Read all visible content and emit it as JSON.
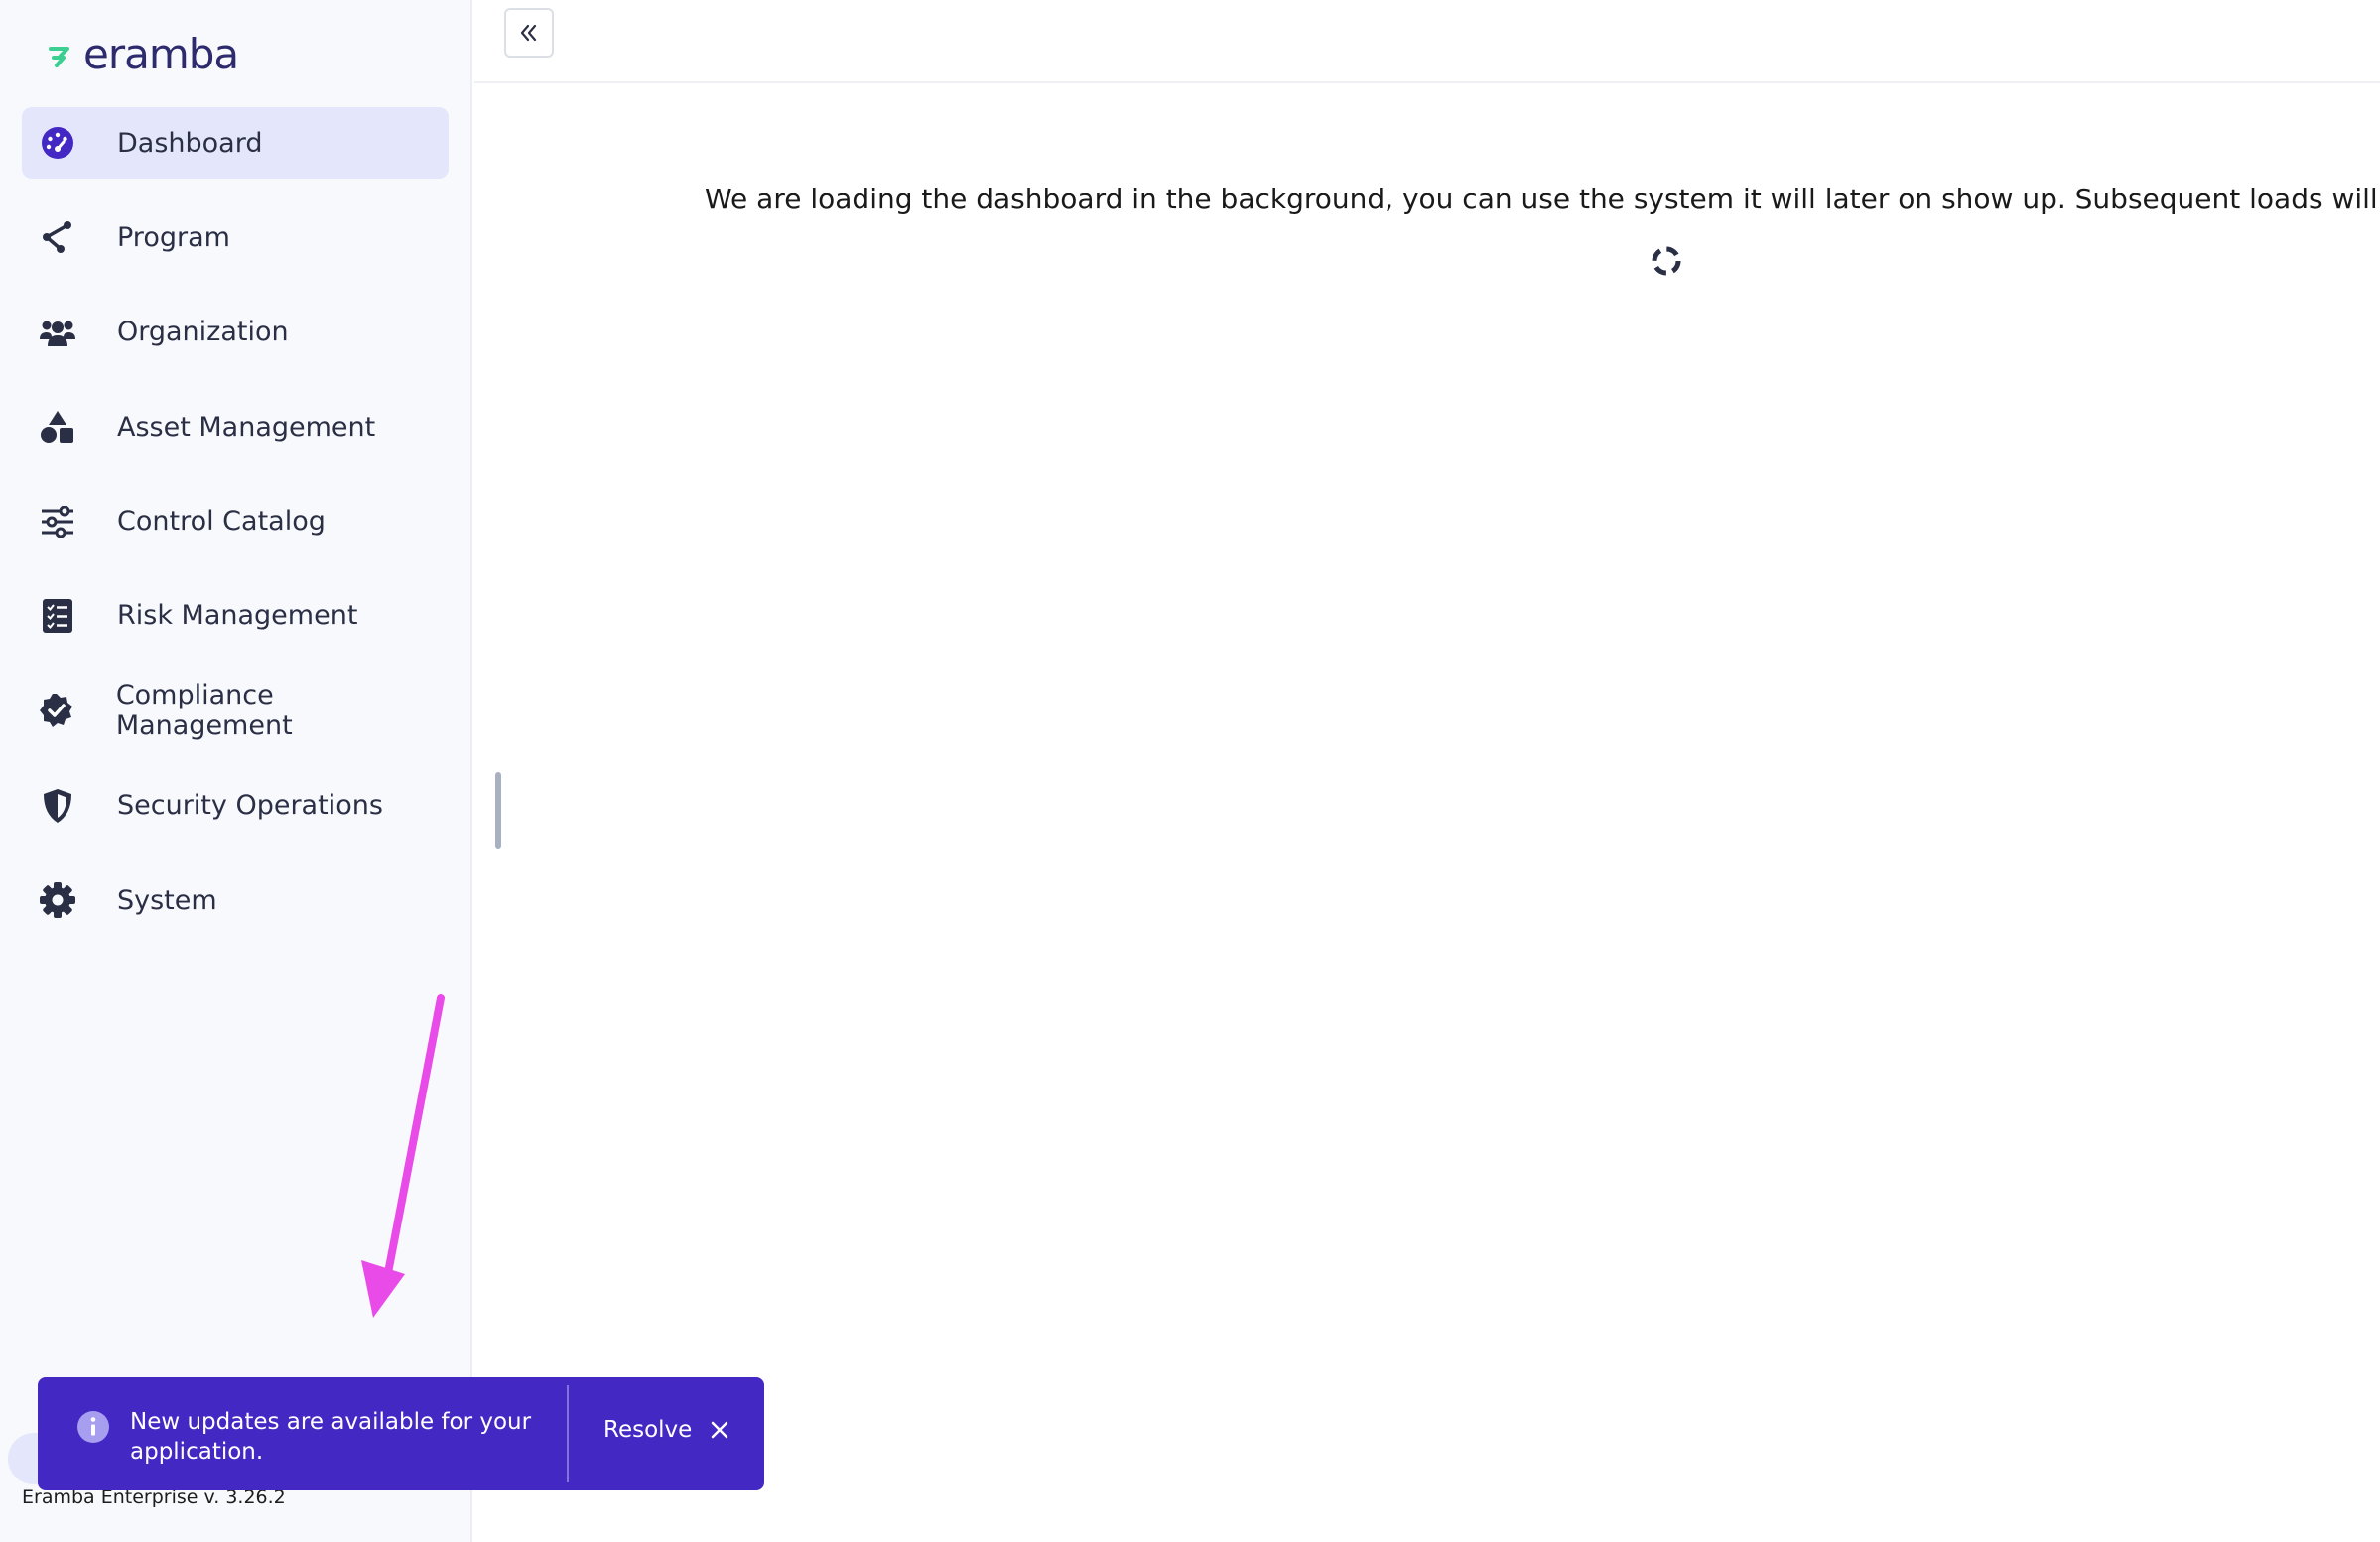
{
  "app": {
    "logo_text": "eramba",
    "version": "Eramba Enterprise v. 3.26.2"
  },
  "sidebar": {
    "items": [
      {
        "label": "Dashboard",
        "icon": "dashboard-icon",
        "active": true
      },
      {
        "label": "Program",
        "icon": "program-icon",
        "active": false
      },
      {
        "label": "Organization",
        "icon": "users-icon",
        "active": false
      },
      {
        "label": "Asset Management",
        "icon": "shapes-icon",
        "active": false
      },
      {
        "label": "Control Catalog",
        "icon": "sliders-icon",
        "active": false
      },
      {
        "label": "Risk Management",
        "icon": "checklist-icon",
        "active": false
      },
      {
        "label": "Compliance Management",
        "icon": "badge-check-icon",
        "active": false
      },
      {
        "label": "Security Operations",
        "icon": "shield-icon",
        "active": false
      },
      {
        "label": "System",
        "icon": "gear-icon",
        "active": false
      }
    ]
  },
  "main": {
    "loading_message": "We are loading the dashboard in the background, you can use the system it will later on show up. Subsequent loads will be cache"
  },
  "toast": {
    "message": "New updates are available for your application.",
    "action_label": "Resolve",
    "background": "#4328c4"
  },
  "colors": {
    "brand_dark": "#2d2a6e",
    "brand_green": "#3ccf91",
    "active_bg": "#e4e7fb",
    "annotation_arrow": "#e94be8"
  }
}
